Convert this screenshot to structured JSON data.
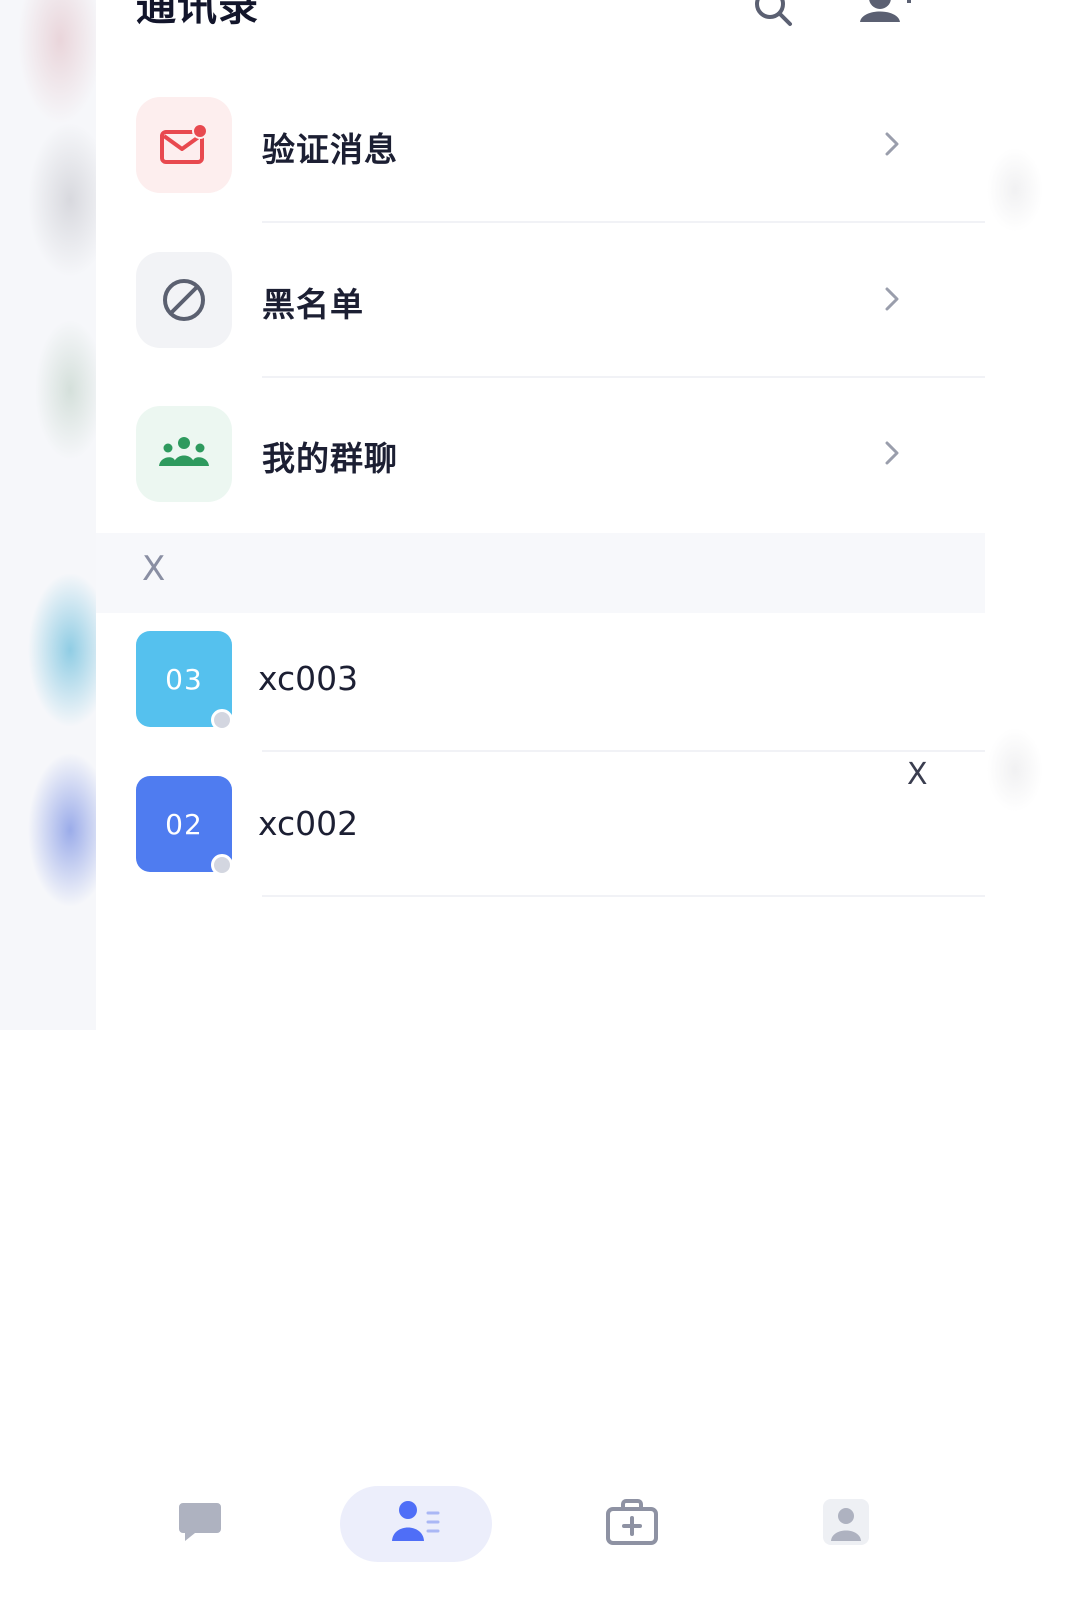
{
  "header": {
    "title": "通讯录",
    "search_icon": "search-icon",
    "add_icon": "add-contact-icon"
  },
  "menu": [
    {
      "label": "验证消息",
      "icon": "mail-notification-icon",
      "icon_bg": "#fdeeee",
      "icon_color": "#e8494f"
    },
    {
      "label": "黑名单",
      "icon": "block-icon",
      "icon_bg": "#f2f3f6",
      "icon_color": "#5b6070"
    },
    {
      "label": "我的群聊",
      "icon": "group-icon",
      "icon_bg": "#ecf7f1",
      "icon_color": "#2e9a5e"
    }
  ],
  "section": {
    "letter": "X"
  },
  "contacts": [
    {
      "avatar_text": "03",
      "name": "xc003",
      "avatar_color": "#55c1ee"
    },
    {
      "avatar_text": "02",
      "name": "xc002",
      "avatar_color": "#4f7cf0"
    }
  ],
  "index_bar": {
    "letter": "X"
  },
  "tabbar": {
    "tabs": [
      {
        "icon": "chat-icon",
        "active": false
      },
      {
        "icon": "contacts-icon",
        "active": true
      },
      {
        "icon": "toolbox-icon",
        "active": false
      },
      {
        "icon": "profile-icon",
        "active": false
      }
    ],
    "accent": "#4f6ef7"
  }
}
